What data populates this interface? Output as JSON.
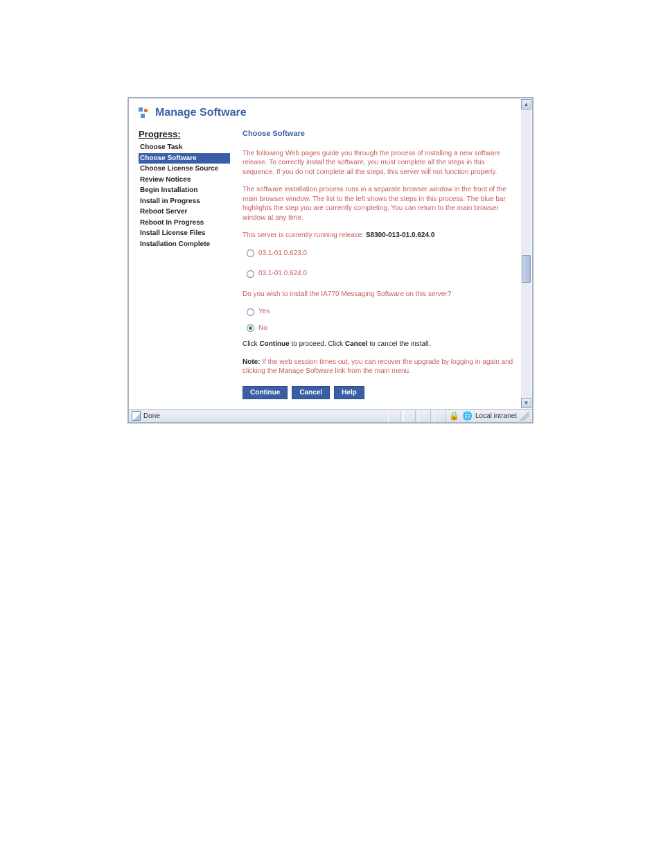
{
  "page": {
    "title": "Manage Software"
  },
  "sidebar": {
    "heading": "Progress:",
    "items": [
      {
        "label": "Choose Task"
      },
      {
        "label": "Choose Software"
      },
      {
        "label": "Choose License Source"
      },
      {
        "label": "Review Notices"
      },
      {
        "label": "Begin Installation"
      },
      {
        "label": "Install in Progress"
      },
      {
        "label": "Reboot Server"
      },
      {
        "label": "Reboot In Progress"
      },
      {
        "label": "Install License Files"
      },
      {
        "label": "Installation Complete"
      }
    ],
    "activeIndex": 1
  },
  "content": {
    "heading": "Choose Software",
    "para1": "The following Web pages guide you through the process of installing a new software release. To correctly install the software, you must complete all the steps in this sequence. If you do not complete all the steps, this server will not function properly.",
    "para2": "The software installation process runs in a separate browser window in the front of the main browser window. The list to the left shows the steps in this process. The blue bar highlights the step you are currently completing. You can return to the main browser window at any time.",
    "running_prefix": "This server is currently running release: ",
    "running_version": "S8300-013-01.0.624.0",
    "version_options": [
      {
        "label": "03.1-01.0.623.0",
        "selected": false
      },
      {
        "label": "03.1-01.0.624.0",
        "selected": false
      }
    ],
    "ia770_question": "Do you wish to install the IA770 Messaging Software on this server?",
    "ia770_options": [
      {
        "label": "Yes",
        "selected": false
      },
      {
        "label": "No",
        "selected": true
      }
    ],
    "proceed_line": {
      "pre": "Click ",
      "b1": "Continue",
      "mid": " to proceed. Click ",
      "b2": "Cancel",
      "post": " to cancel the install."
    },
    "note": {
      "label": "Note:",
      "text": " If the web session times out, you can recover the upgrade by logging in again and clicking the Manage Software link from the main menu."
    },
    "buttons": {
      "continue": "Continue",
      "cancel": "Cancel",
      "help": "Help"
    }
  },
  "statusbar": {
    "left": "Done",
    "zone": "Local intranet"
  }
}
